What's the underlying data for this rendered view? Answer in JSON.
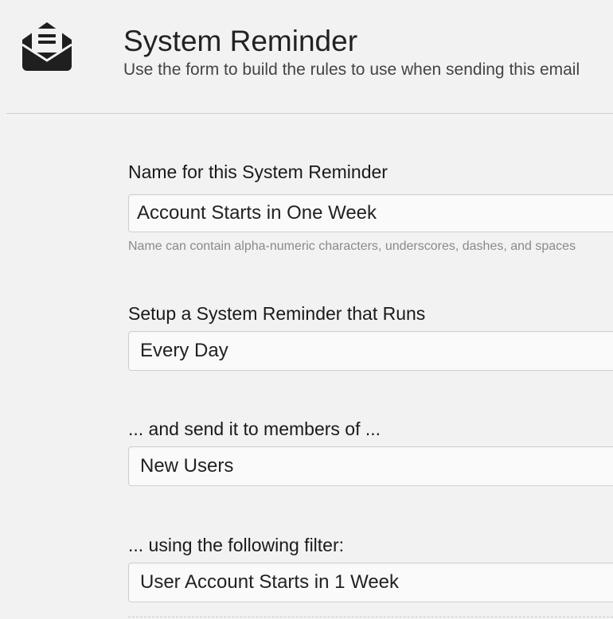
{
  "header": {
    "icon": "open-envelope-icon",
    "title": "System Reminder",
    "subtitle": "Use the form to build the rules to use when sending this email"
  },
  "form": {
    "name": {
      "label": "Name for this System Reminder",
      "value": "Account Starts in One Week",
      "hint": "Name can contain alpha-numeric characters, underscores, dashes, and spaces"
    },
    "schedule": {
      "label": "Setup a System Reminder that Runs",
      "value": "Every Day"
    },
    "recipients": {
      "label": "... and send it to members of ...",
      "value": "New Users"
    },
    "filter": {
      "label": "... using the following filter:",
      "value": "User Account Starts in 1 Week"
    }
  }
}
